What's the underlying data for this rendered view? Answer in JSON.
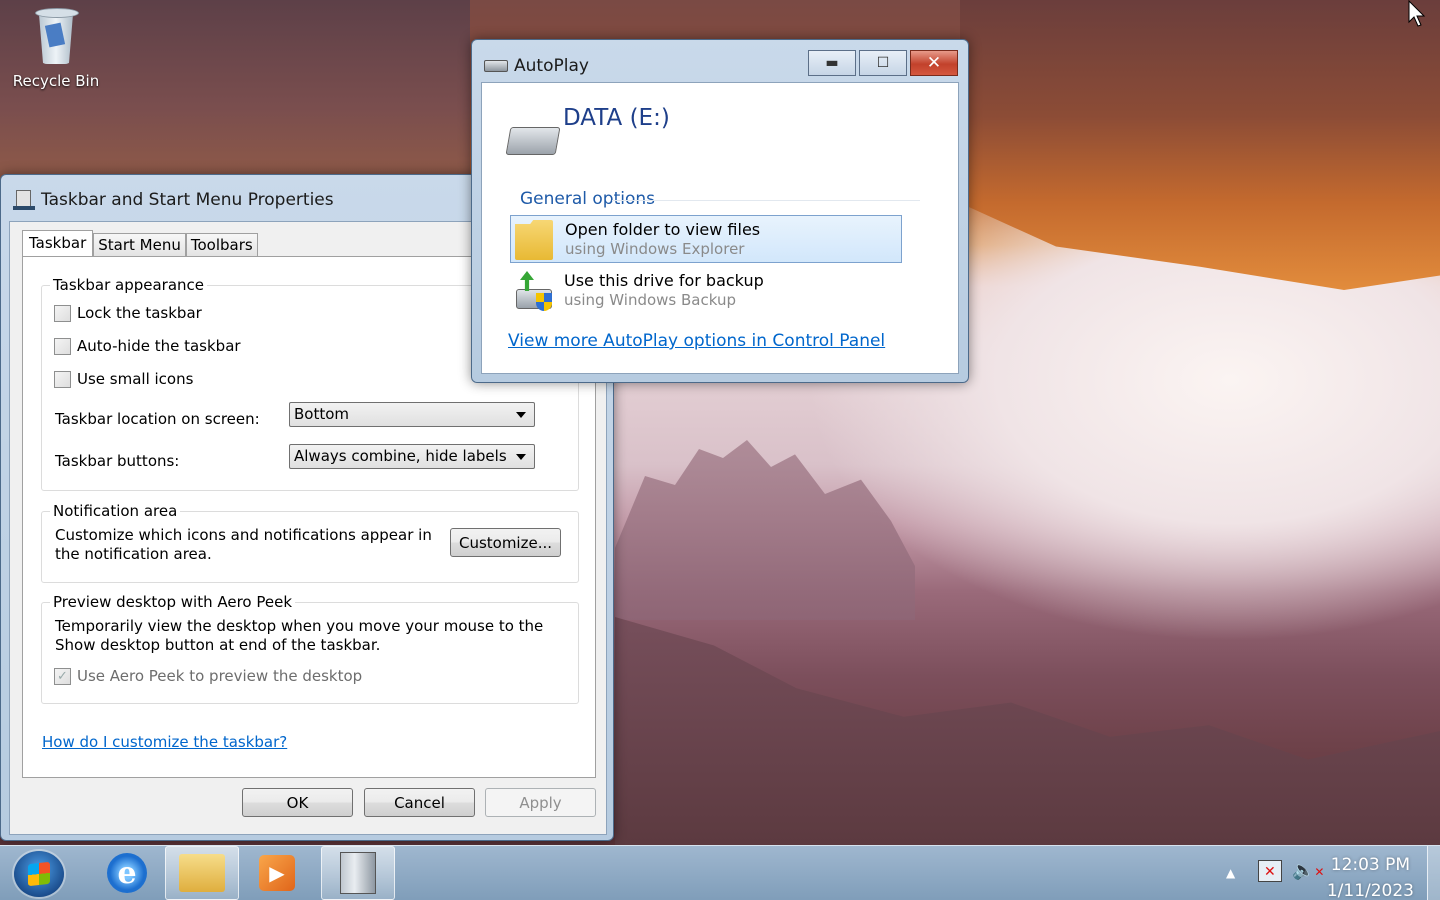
{
  "desktop": {
    "icons": [
      {
        "label": "Recycle Bin",
        "icon": "recycle-bin-icon"
      }
    ]
  },
  "taskbar_props": {
    "title": "Taskbar and Start Menu Properties",
    "tabs": [
      "Taskbar",
      "Start Menu",
      "Toolbars"
    ],
    "appearance": {
      "title": "Taskbar appearance",
      "lock_label": "Lock the taskbar",
      "lock_checked": false,
      "autohide_label": "Auto-hide the taskbar",
      "autohide_checked": false,
      "small_icons_label": "Use small icons",
      "small_icons_checked": false,
      "location_label": "Taskbar location on screen:",
      "location_value": "Bottom",
      "buttons_label": "Taskbar buttons:",
      "buttons_value": "Always combine, hide labels"
    },
    "notification": {
      "title": "Notification area",
      "text": "Customize which icons and notifications appear in the notification area.",
      "customize_label": "Customize..."
    },
    "aero_peek": {
      "title": "Preview desktop with Aero Peek",
      "text": "Temporarily view the desktop when you move your mouse to the Show desktop button at end of the taskbar.",
      "checkbox_label": "Use Aero Peek to preview the desktop",
      "checked": true
    },
    "help_link": "How do I customize the taskbar?",
    "ok_label": "OK",
    "cancel_label": "Cancel",
    "apply_label": "Apply"
  },
  "autoplay": {
    "title": "AutoPlay",
    "drive_label": "DATA (E:)",
    "general_options": "General options",
    "options": [
      {
        "title": "Open folder to view files",
        "subtitle": "using Windows Explorer",
        "icon": "folder-icon"
      },
      {
        "title": "Use this drive for backup",
        "subtitle": "using Windows Backup",
        "icon": "backup-icon"
      }
    ],
    "control_panel_link": "View more AutoPlay options in Control Panel"
  },
  "taskbar": {
    "clock_time": "12:03 PM",
    "clock_date": "1/11/2023",
    "apps": [
      "internet-explorer-icon",
      "windows-explorer-icon",
      "media-player-icon",
      "taskbar-properties-icon"
    ]
  }
}
